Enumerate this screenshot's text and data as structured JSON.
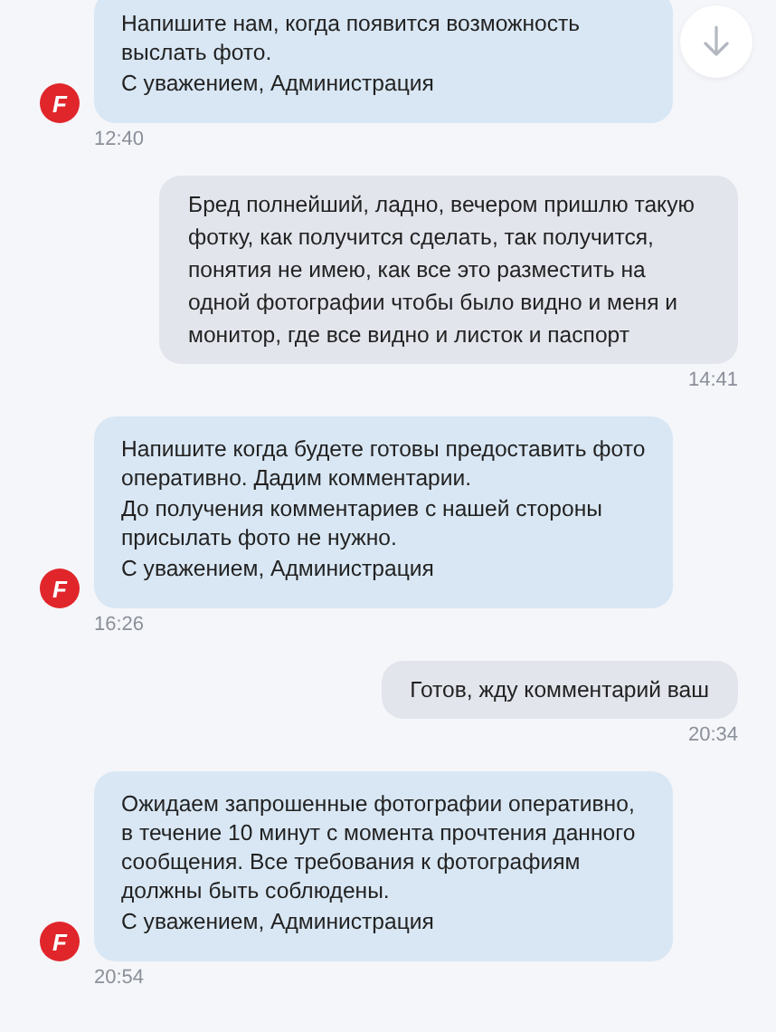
{
  "messages": [
    {
      "kind": "incoming",
      "avatar": "F",
      "paragraphs": [
        "Напишите нам, когда появится возможность выслать фото.",
        "С уважением, Администрация"
      ],
      "time": "12:40"
    },
    {
      "kind": "outgoing",
      "paragraphs": [
        "Бред полнейший, ладно, вечером пришлю такую фотку, как получится сделать, так получится, понятия не имею, как все это разместить на одной фотографии чтобы было видно и меня и монитор, где все видно и листок и паспорт"
      ],
      "time": "14:41"
    },
    {
      "kind": "incoming",
      "avatar": "F",
      "paragraphs": [
        "Напишите когда будете готовы предоставить фото оперативно. Дадим комментарии.",
        "До получения комментариев с нашей стороны присылать фото не нужно.",
        "С уважением, Администрация"
      ],
      "time": "16:26"
    },
    {
      "kind": "outgoing",
      "paragraphs": [
        "Готов, жду комментарий ваш"
      ],
      "time": "20:34"
    },
    {
      "kind": "incoming",
      "avatar": "F",
      "paragraphs": [
        "Ожидаем запрошенные фотографии оперативно, в течение 10 минут с момента прочтения данного сообщения. Все требования к фотографиям должны быть соблюдены.",
        "С уважением, Администрация"
      ],
      "time": "20:54"
    }
  ]
}
